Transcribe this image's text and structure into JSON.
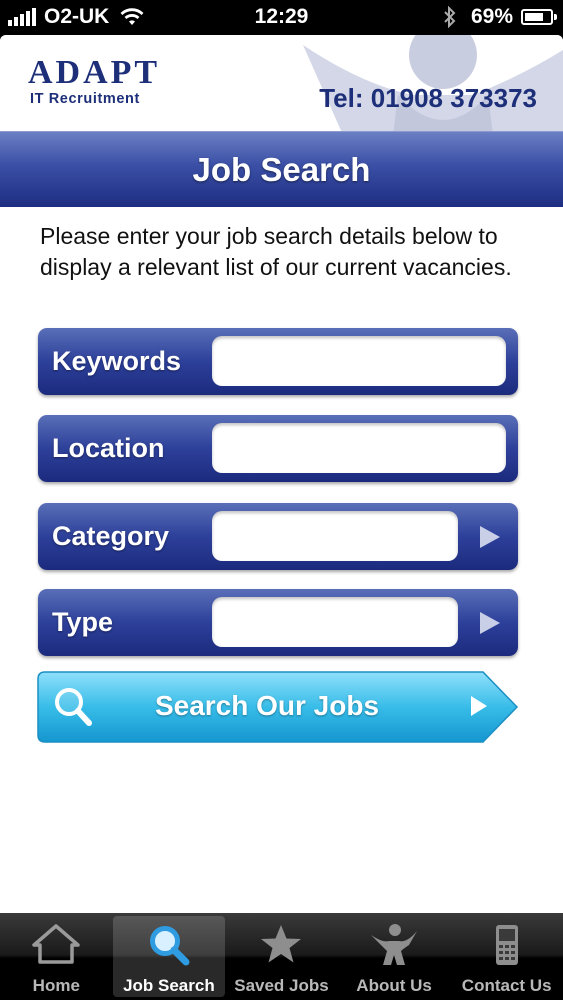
{
  "status_bar": {
    "carrier": "O2-UK",
    "time": "12:29",
    "battery": "69%"
  },
  "header": {
    "logo_main": "ADAPT",
    "logo_sub": "IT Recruitment",
    "phone": "Tel: 01908 373373"
  },
  "title": "Job Search",
  "intro": "Please enter your job search details below to display a relevant list of our current vacancies.",
  "fields": {
    "keywords": {
      "label": "Keywords",
      "value": ""
    },
    "location": {
      "label": "Location",
      "value": ""
    },
    "category": {
      "label": "Category",
      "value": ""
    },
    "type": {
      "label": "Type",
      "value": ""
    }
  },
  "search_button": {
    "label": "Search Our Jobs",
    "icon": "search-icon"
  },
  "tabs": [
    {
      "label": "Home",
      "icon": "home-icon"
    },
    {
      "label": "Job Search",
      "icon": "search-icon",
      "active": true
    },
    {
      "label": "Saved Jobs",
      "icon": "star-icon"
    },
    {
      "label": "About Us",
      "icon": "person-icon"
    },
    {
      "label": "Contact Us",
      "icon": "phone-icon"
    }
  ],
  "colors": {
    "brand_blue": "#1e2f7a",
    "field_blue": "#2d409a",
    "search_cyan": "#2bb4e4"
  }
}
